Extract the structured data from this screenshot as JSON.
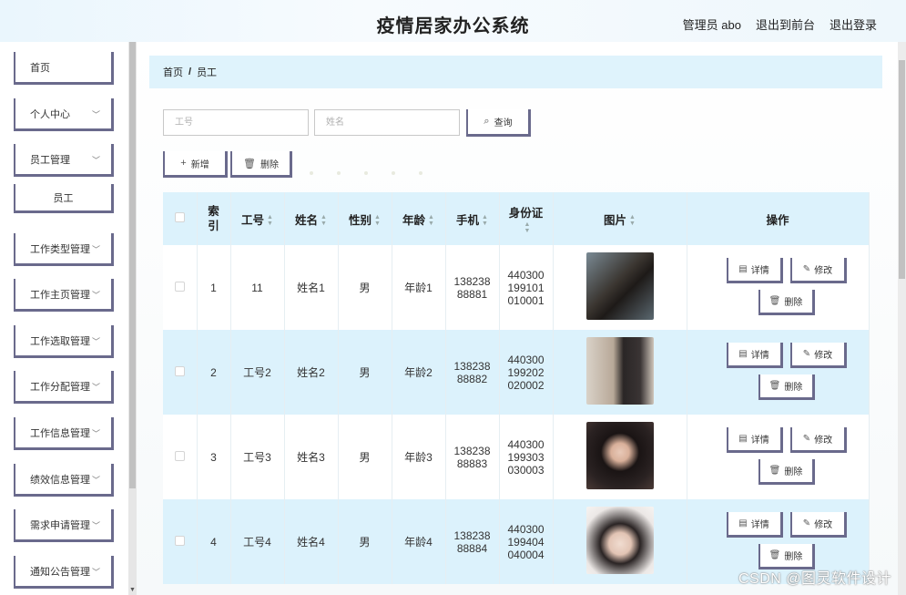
{
  "header": {
    "title": "疫情居家办公系统",
    "admin_label": "管理员 abo",
    "to_front": "退出到前台",
    "logout": "退出登录"
  },
  "sidebar": {
    "items": [
      {
        "label": "首页",
        "has_chevron": false
      },
      {
        "label": "个人中心",
        "has_chevron": true
      },
      {
        "label": "员工管理",
        "has_chevron": true
      },
      {
        "label": "员工",
        "sub": true
      },
      {
        "label": "工作类型管理",
        "has_chevron": true
      },
      {
        "label": "工作主页管理",
        "has_chevron": true
      },
      {
        "label": "工作选取管理",
        "has_chevron": true
      },
      {
        "label": "工作分配管理",
        "has_chevron": true
      },
      {
        "label": "工作信息管理",
        "has_chevron": true
      },
      {
        "label": "绩效信息管理",
        "has_chevron": true
      },
      {
        "label": "需求申请管理",
        "has_chevron": true
      },
      {
        "label": "通知公告管理",
        "has_chevron": true
      }
    ]
  },
  "breadcrumb": {
    "home": "首页",
    "sep": "/",
    "current": "员工"
  },
  "search": {
    "gonghao_placeholder": "工号",
    "name_placeholder": "姓名",
    "query_label": "查询"
  },
  "actions": {
    "add_label": "新增",
    "delete_label": "删除"
  },
  "table": {
    "columns": {
      "index": "索引",
      "gonghao": "工号",
      "name": "姓名",
      "gender": "性别",
      "age": "年龄",
      "phone": "手机",
      "idcard": "身份证",
      "photo": "图片",
      "ops": "操作"
    },
    "op_labels": {
      "detail": "详情",
      "edit": "修改",
      "delete": "删除"
    },
    "rows": [
      {
        "index": "1",
        "gonghao": "11",
        "name": "姓名1",
        "gender": "男",
        "age": "年龄1",
        "phone_a": "138238",
        "phone_b": "88881",
        "id_a": "440300",
        "id_b": "199101",
        "id_c": "010001"
      },
      {
        "index": "2",
        "gonghao": "工号2",
        "name": "姓名2",
        "gender": "男",
        "age": "年龄2",
        "phone_a": "138238",
        "phone_b": "88882",
        "id_a": "440300",
        "id_b": "199202",
        "id_c": "020002"
      },
      {
        "index": "3",
        "gonghao": "工号3",
        "name": "姓名3",
        "gender": "男",
        "age": "年龄3",
        "phone_a": "138238",
        "phone_b": "88883",
        "id_a": "440300",
        "id_b": "199303",
        "id_c": "030003"
      },
      {
        "index": "4",
        "gonghao": "工号4",
        "name": "姓名4",
        "gender": "男",
        "age": "年龄4",
        "phone_a": "138238",
        "phone_b": "88884",
        "id_a": "440300",
        "id_b": "199404",
        "id_c": "040004"
      }
    ]
  },
  "watermark": "CSDN @图灵软件设计",
  "colors": {
    "accent_border": "#6a6a8c",
    "row_highlight": "#dcf2fc",
    "breadcrumb_bg": "#dff3fc"
  }
}
